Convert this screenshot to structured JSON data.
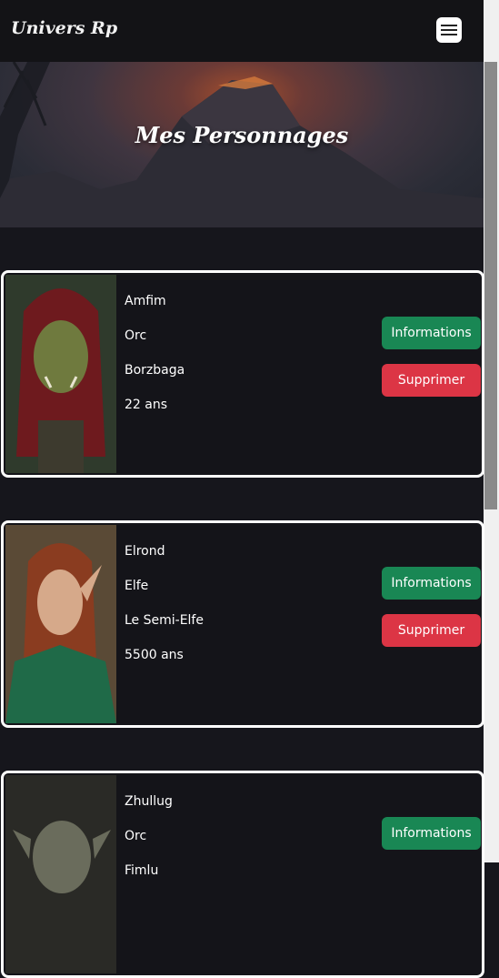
{
  "navbar": {
    "brand": "Univers Rp",
    "menu_icon": "hamburger-icon"
  },
  "hero": {
    "title": "Mes Personnages"
  },
  "colors": {
    "info_button": "#198754",
    "delete_button": "#dc3545",
    "card_border": "#ffffff"
  },
  "characters": [
    {
      "name": "Amfim",
      "race": "Orc",
      "surname": "Borzbaga",
      "age": "22 ans",
      "info_label": "Informations",
      "delete_label": "Supprimer"
    },
    {
      "name": "Elrond",
      "race": "Elfe",
      "surname": "Le Semi-Elfe",
      "age": "5500 ans",
      "info_label": "Informations",
      "delete_label": "Supprimer"
    },
    {
      "name": "Zhullug",
      "race": "Orc",
      "surname": "Fimlu",
      "info_label": "Informations"
    }
  ]
}
